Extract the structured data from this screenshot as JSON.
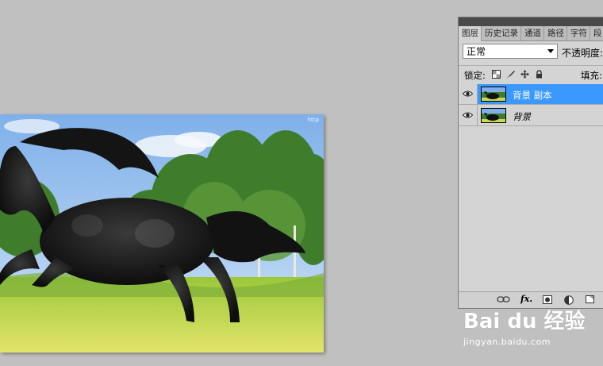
{
  "panel": {
    "tabs": [
      "图层",
      "历史记录",
      "通道",
      "路径",
      "字符",
      "段"
    ],
    "blend_mode": "正常",
    "opacity_label": "不透明度:",
    "lock_label": "锁定:",
    "fill_label": "填充:",
    "layers": [
      {
        "name": "背景 副本",
        "selected": true,
        "visible": true
      },
      {
        "name": "背景",
        "selected": false,
        "visible": true
      }
    ],
    "bottom_icons": [
      "link-icon",
      "fx-icon",
      "mask-icon",
      "adjustment-icon",
      "new-layer-icon"
    ],
    "fx_label": "fx."
  },
  "photo": {
    "watermark_small": "http"
  },
  "watermark": {
    "main": "Bai du 经验",
    "sub": "jingyan.baidu.com"
  },
  "colors": {
    "workspace": "#c0c0c0",
    "selection": "#3b98ff",
    "panel": "#d4d4d4"
  }
}
